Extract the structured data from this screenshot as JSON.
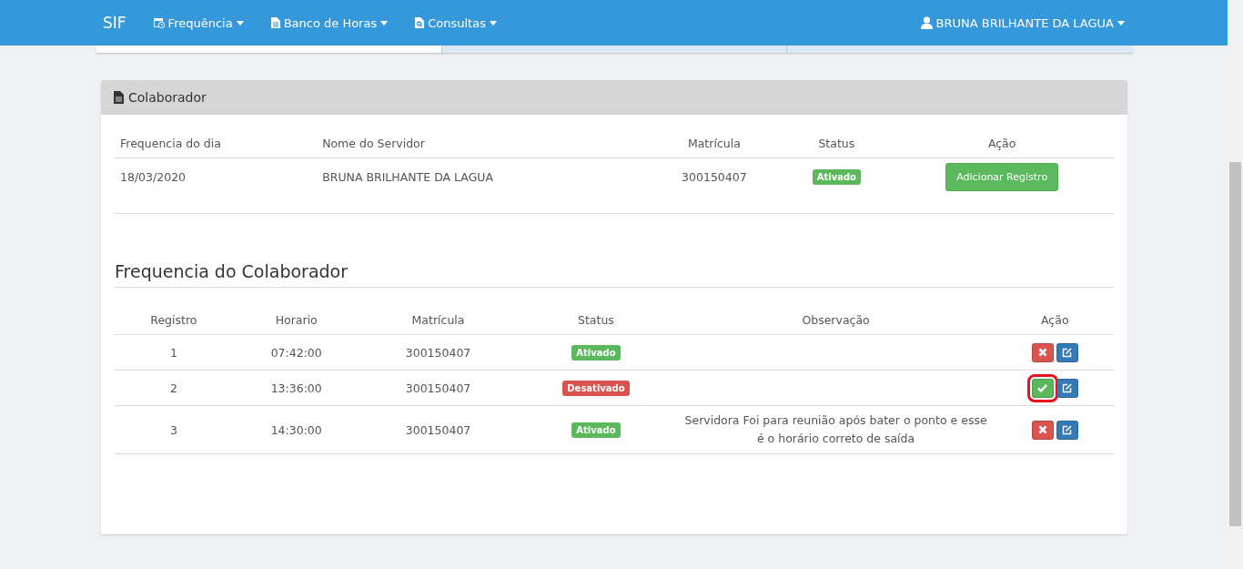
{
  "navbar": {
    "brand": "SIF",
    "menus": [
      {
        "label": "Frequência"
      },
      {
        "label": "Banco de Horas"
      },
      {
        "label": "Consultas"
      }
    ],
    "user": "BRUNA BRILHANTE DA LAGUA"
  },
  "panel": {
    "title": "Colaborador",
    "columns": [
      "Frequencia do dia",
      "Nome do Servidor",
      "Matrícula",
      "Status",
      "Ação"
    ],
    "row": {
      "date": "18/03/2020",
      "name": "BRUNA BRILHANTE DA LAGUA",
      "matricula": "300150407",
      "status": {
        "label": "Ativado",
        "kind": "active"
      },
      "button": "Adicionar Registro"
    },
    "section_title": "Frequencia do Colaborador",
    "records_columns": [
      "Registro",
      "Horario",
      "Matrícula",
      "Status",
      "Observação",
      "Ação"
    ],
    "records": [
      {
        "registro": "1",
        "horario": "07:42:00",
        "matricula": "300150407",
        "status": {
          "label": "Ativado",
          "kind": "active"
        },
        "actions": [
          {
            "kind": "delete",
            "highlighted": false
          },
          {
            "kind": "edit",
            "highlighted": false
          }
        ]
      },
      {
        "registro": "2",
        "horario": "13:36:00",
        "matricula": "300150407",
        "status": {
          "label": "Desativado",
          "kind": "inactive"
        },
        "actions": [
          {
            "kind": "confirm",
            "highlighted": true
          },
          {
            "kind": "edit",
            "highlighted": false
          }
        ]
      },
      {
        "registro": "3",
        "horario": "14:30:00",
        "matricula": "300150407",
        "status": {
          "label": "Ativado",
          "kind": "active"
        },
        "observacao": "Servidora Foi para reunião após bater o ponto e esse é o horário correto de saída",
        "actions": [
          {
            "kind": "delete",
            "highlighted": false
          },
          {
            "kind": "edit",
            "highlighted": false
          }
        ]
      }
    ]
  }
}
